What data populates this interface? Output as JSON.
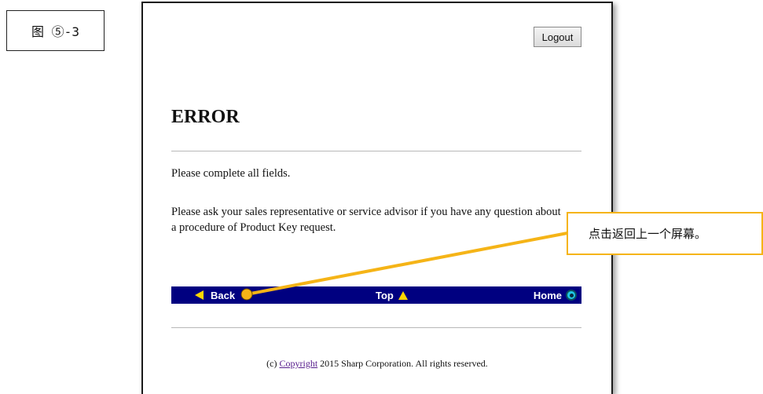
{
  "figure_label": "图 ⑤-3",
  "header": {
    "logout_label": "Logout"
  },
  "main": {
    "title": "ERROR",
    "message1": "Please complete all fields.",
    "message2": "Please ask your sales representative or service advisor if you have any question about a procedure of Product Key request."
  },
  "navbar": {
    "back_label": "Back",
    "top_label": "Top",
    "home_label": "Home",
    "bg_color": "#000080",
    "icon_color": "#ffd700"
  },
  "footer": {
    "prefix": "(c)",
    "link_label": "Copyright",
    "suffix": "2015 Sharp Corporation. All rights reserved."
  },
  "callout": {
    "text": "点击返回上一个屏幕。",
    "color": "#f5b417"
  }
}
